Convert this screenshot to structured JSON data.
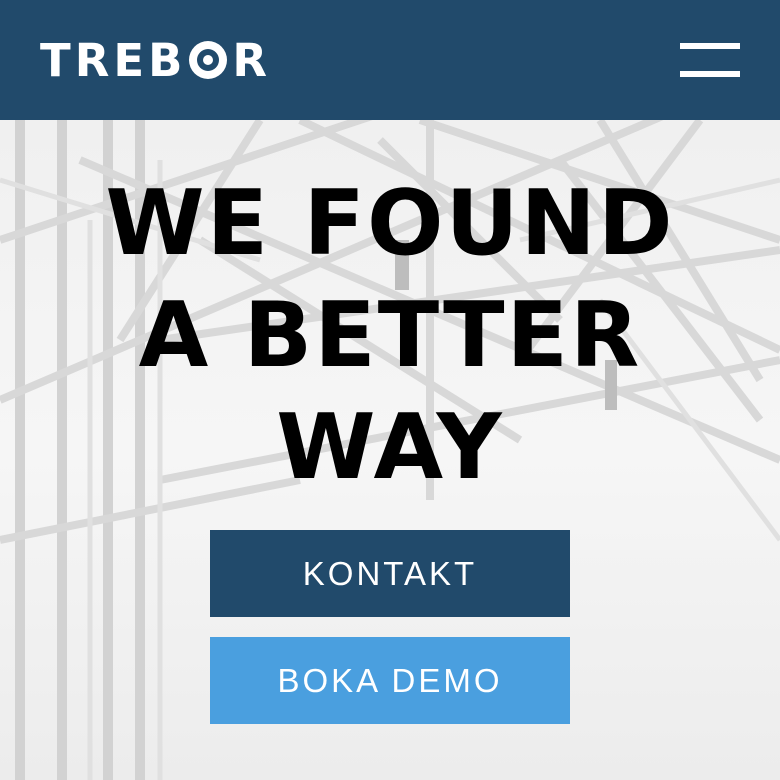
{
  "header": {
    "logo_prefix": "TREB",
    "logo_suffix": "R",
    "background_color": "#214a6b",
    "menu_icon": "hamburger-menu-icon"
  },
  "hero": {
    "headline_lines": [
      "WE FOUND",
      "A BETTER",
      "WAY"
    ],
    "background_image": "steel roof truss structure, greyscale"
  },
  "buttons": {
    "contact_label": "KONTAKT",
    "contact_color": "#214a6b",
    "demo_label": "BOKA DEMO",
    "demo_color": "#4a9fdf"
  }
}
